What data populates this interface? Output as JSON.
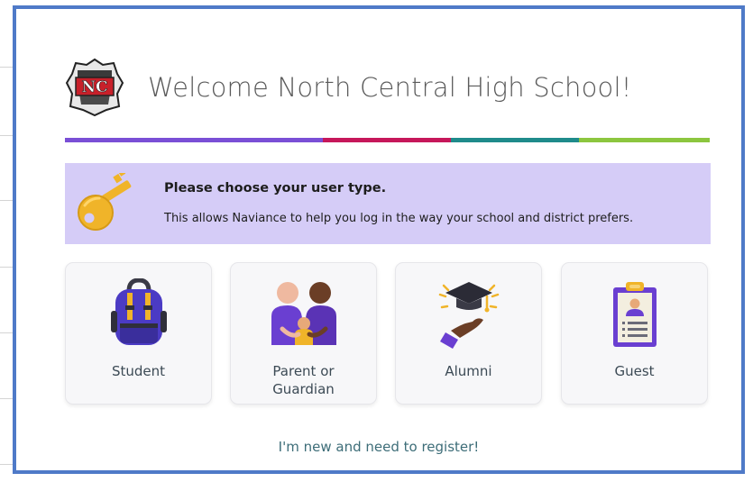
{
  "header": {
    "title": "Welcome North Central High School!",
    "logo_icon": "school-crest-icon",
    "logo_text": "NC"
  },
  "stripe_colors": [
    "#7a4fd6",
    "#c6175a",
    "#1f8b8b",
    "#8cc63f"
  ],
  "notice": {
    "title": "Please choose your user type.",
    "text": "This allows Naviance to help you log in the way your school and district prefers.",
    "icon": "key-icon"
  },
  "user_types": [
    {
      "label": "Student",
      "icon": "backpack-icon"
    },
    {
      "label": "Parent or Guardian",
      "icon": "family-icon"
    },
    {
      "label": "Alumni",
      "icon": "graduation-cap-icon"
    },
    {
      "label": "Guest",
      "icon": "clipboard-icon"
    }
  ],
  "register_link": "I'm new and need to register!",
  "colors": {
    "frame_border": "#4f7ac8",
    "notice_bg": "#d5ccf7",
    "accent_purple": "#6a3fd1",
    "link": "#3d6d78"
  }
}
